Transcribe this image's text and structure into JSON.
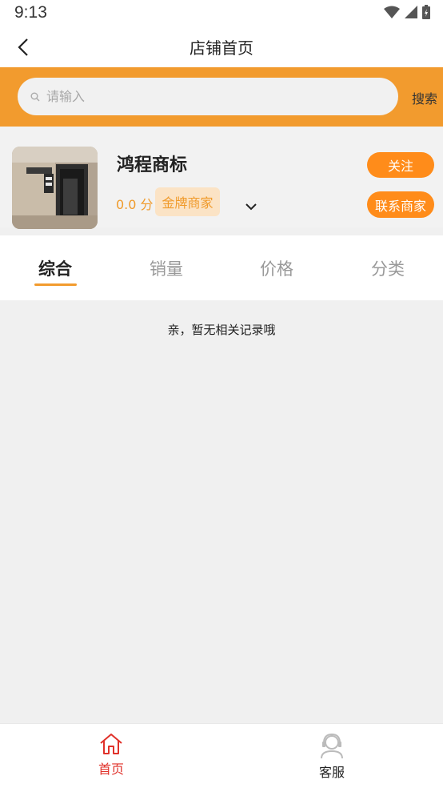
{
  "status_bar": {
    "time": "9:13"
  },
  "nav": {
    "title": "店铺首页"
  },
  "search": {
    "placeholder": "请输入",
    "button_label": "搜索"
  },
  "shop": {
    "name": "鸿程商标",
    "score": "0.0 分",
    "badge": "金牌商家",
    "follow_label": "关注",
    "contact_label": "联系商家"
  },
  "tabs": [
    {
      "label": "综合",
      "active": true
    },
    {
      "label": "销量",
      "active": false
    },
    {
      "label": "价格",
      "active": false
    },
    {
      "label": "分类",
      "active": false
    }
  ],
  "empty_message": "亲，暂无相关记录哦",
  "bottom_nav": [
    {
      "label": "首页",
      "icon": "home-icon",
      "active": true
    },
    {
      "label": "客服",
      "icon": "customer-service-icon",
      "active": false
    }
  ],
  "colors": {
    "brand_orange": "#f29b2e",
    "button_orange": "#ff8c1a",
    "active_red": "#e0312a"
  }
}
